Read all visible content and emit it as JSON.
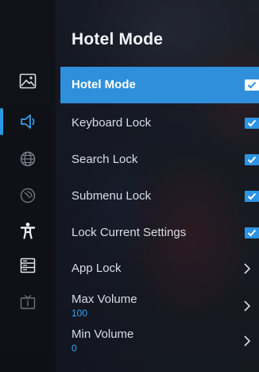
{
  "title": "Hotel Mode",
  "sidebar": {
    "items": [
      {
        "icon": "picture-icon",
        "active": false
      },
      {
        "icon": "sound-icon",
        "active": true
      },
      {
        "icon": "network-icon",
        "active": false
      },
      {
        "icon": "channel-icon",
        "active": false
      },
      {
        "icon": "accessibility-icon",
        "active": false
      },
      {
        "icon": "system-icon",
        "active": false
      },
      {
        "icon": "support-icon",
        "active": false
      }
    ]
  },
  "menu": {
    "items": [
      {
        "label": "Hotel Mode",
        "control": "checkbox",
        "checked": true,
        "selected": true
      },
      {
        "label": "Keyboard Lock",
        "control": "checkbox",
        "checked": true
      },
      {
        "label": "Search Lock",
        "control": "checkbox",
        "checked": true
      },
      {
        "label": "Submenu Lock",
        "control": "checkbox",
        "checked": true
      },
      {
        "label": "Lock Current Settings",
        "control": "checkbox",
        "checked": true
      },
      {
        "label": "App Lock",
        "control": "chevron"
      },
      {
        "label": "Max Volume",
        "value": "100",
        "control": "chevron"
      },
      {
        "label": "Min Volume",
        "value": "0",
        "control": "chevron"
      }
    ]
  },
  "colors": {
    "accent": "#2f8fda",
    "value_text": "#3aa3ee"
  }
}
